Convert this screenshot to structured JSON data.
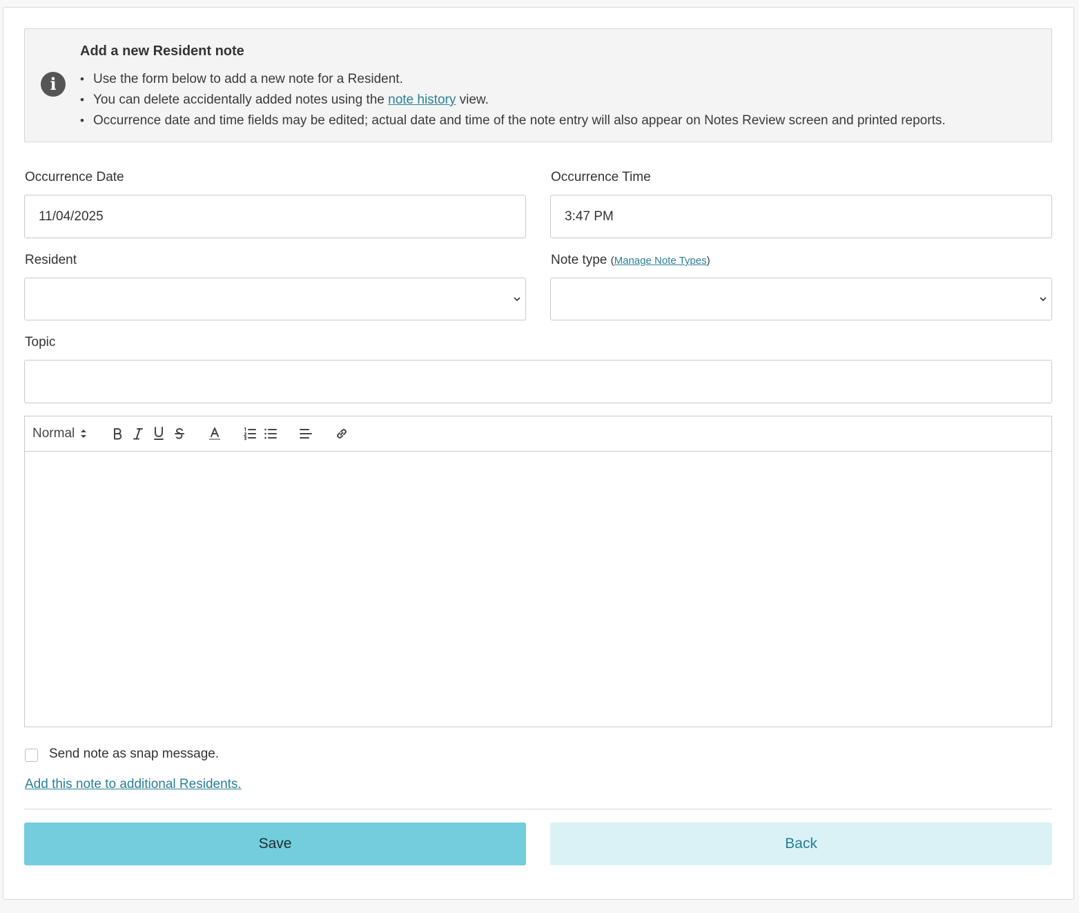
{
  "info": {
    "title": "Add a new Resident note",
    "bullet1": "Use the form below to add a new note for a Resident.",
    "bullet2_pre": "You can delete accidentally added notes using the ",
    "bullet2_link": "note history",
    "bullet2_post": " view.",
    "bullet3": "Occurrence date and time fields may be edited; actual date and time of the note entry will also appear on Notes Review screen and printed reports."
  },
  "form": {
    "date_label": "Occurrence Date",
    "date_value": "11/04/2025",
    "time_label": "Occurrence Time",
    "time_value": "3:47 PM",
    "resident_label": "Resident",
    "resident_value": "",
    "note_type_label": "Note type",
    "manage_note_types_link": "Manage Note Types",
    "note_type_value": "",
    "topic_label": "Topic",
    "topic_value": ""
  },
  "editor": {
    "style_select": "Normal",
    "body": ""
  },
  "snap": {
    "checked": false,
    "label": "Send note as snap message."
  },
  "add_link": "Add this note to additional Residents.",
  "buttons": {
    "save": "Save",
    "back": "Back"
  },
  "colors": {
    "save_bg": "#73cddd",
    "back_bg": "#daf2f6",
    "link": "#2a7f96"
  }
}
